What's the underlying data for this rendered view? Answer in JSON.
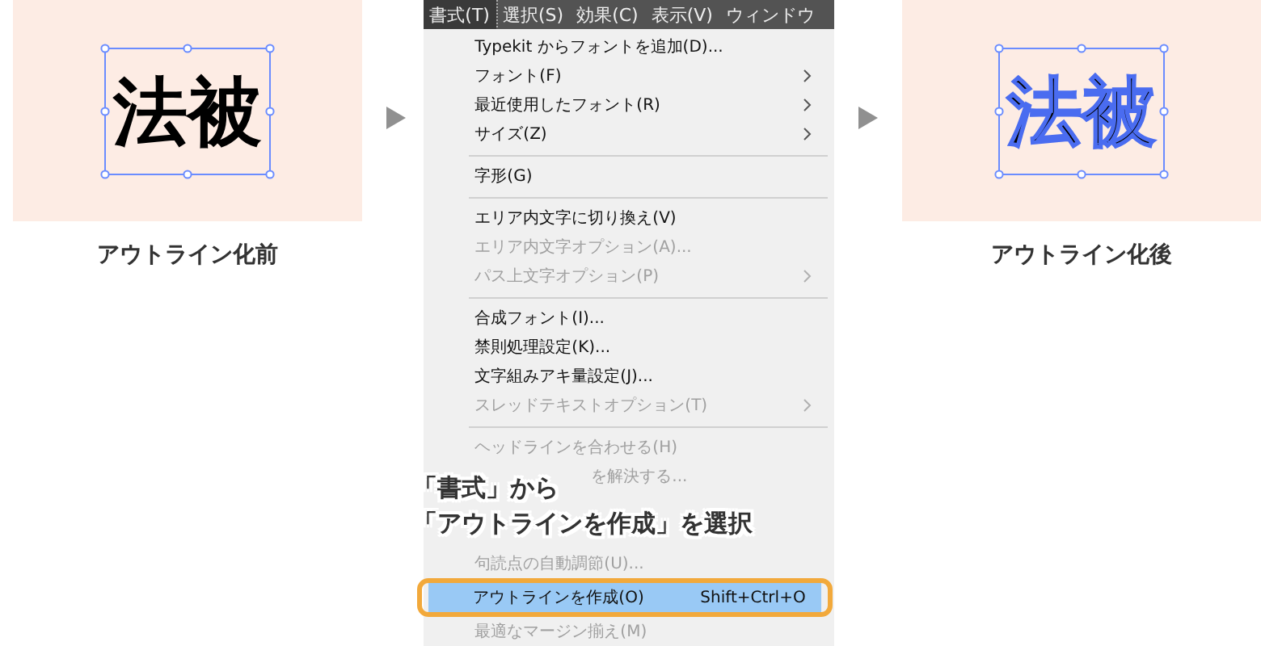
{
  "before": {
    "sample_text": "法被",
    "caption": "アウトライン化前"
  },
  "after": {
    "sample_text": "法被",
    "caption": "アウトライン化後"
  },
  "menu_bar": [
    {
      "label": "書式(T)",
      "selected": true
    },
    {
      "label": "選択(S)",
      "selected": false
    },
    {
      "label": "効果(C)",
      "selected": false
    },
    {
      "label": "表示(V)",
      "selected": false
    },
    {
      "label": "ウィンドウ",
      "selected": false
    }
  ],
  "menu": [
    {
      "kind": "item",
      "label": "Typekit からフォントを追加(D)...",
      "disabled": false,
      "submenu": false,
      "selected": false
    },
    {
      "kind": "item",
      "label": "フォント(F)",
      "disabled": false,
      "submenu": true,
      "selected": false
    },
    {
      "kind": "item",
      "label": "最近使用したフォント(R)",
      "disabled": false,
      "submenu": true,
      "selected": false
    },
    {
      "kind": "item",
      "label": "サイズ(Z)",
      "disabled": false,
      "submenu": true,
      "selected": false
    },
    {
      "kind": "separator"
    },
    {
      "kind": "item",
      "label": "字形(G)",
      "disabled": false,
      "submenu": false,
      "selected": false
    },
    {
      "kind": "separator"
    },
    {
      "kind": "item",
      "label": "エリア内文字に切り換え(V)",
      "disabled": false,
      "submenu": false,
      "selected": false
    },
    {
      "kind": "item",
      "label": "エリア内文字オプション(A)...",
      "disabled": true,
      "submenu": false,
      "selected": false
    },
    {
      "kind": "item",
      "label": "パス上文字オプション(P)",
      "disabled": true,
      "submenu": true,
      "selected": false
    },
    {
      "kind": "separator"
    },
    {
      "kind": "item",
      "label": "合成フォント(I)...",
      "disabled": false,
      "submenu": false,
      "selected": false
    },
    {
      "kind": "item",
      "label": "禁則処理設定(K)...",
      "disabled": false,
      "submenu": false,
      "selected": false
    },
    {
      "kind": "item",
      "label": "文字組みアキ量設定(J)...",
      "disabled": false,
      "submenu": false,
      "selected": false
    },
    {
      "kind": "item",
      "label": "スレッドテキストオプション(T)",
      "disabled": true,
      "submenu": true,
      "selected": false
    },
    {
      "kind": "separator"
    },
    {
      "kind": "item",
      "label": "ヘッドラインを合わせる(H)",
      "disabled": true,
      "submenu": false,
      "selected": false
    },
    {
      "kind": "partial",
      "label": "を解決する...",
      "disabled": true,
      "submenu": false,
      "selected": false
    },
    {
      "kind": "covered"
    },
    {
      "kind": "covered"
    },
    {
      "kind": "item",
      "label": "句読点の自動調節(U)...",
      "disabled": true,
      "submenu": false,
      "selected": false
    },
    {
      "kind": "item",
      "label": "アウトラインを作成(O)",
      "shortcut": "Shift+Ctrl+O",
      "disabled": false,
      "submenu": false,
      "selected": true
    },
    {
      "kind": "item",
      "label": "最適なマージン揃え(M)",
      "disabled": true,
      "submenu": false,
      "selected": false
    }
  ],
  "callout": [
    "「書式」から",
    "「アウトラインを作成」を選択"
  ]
}
